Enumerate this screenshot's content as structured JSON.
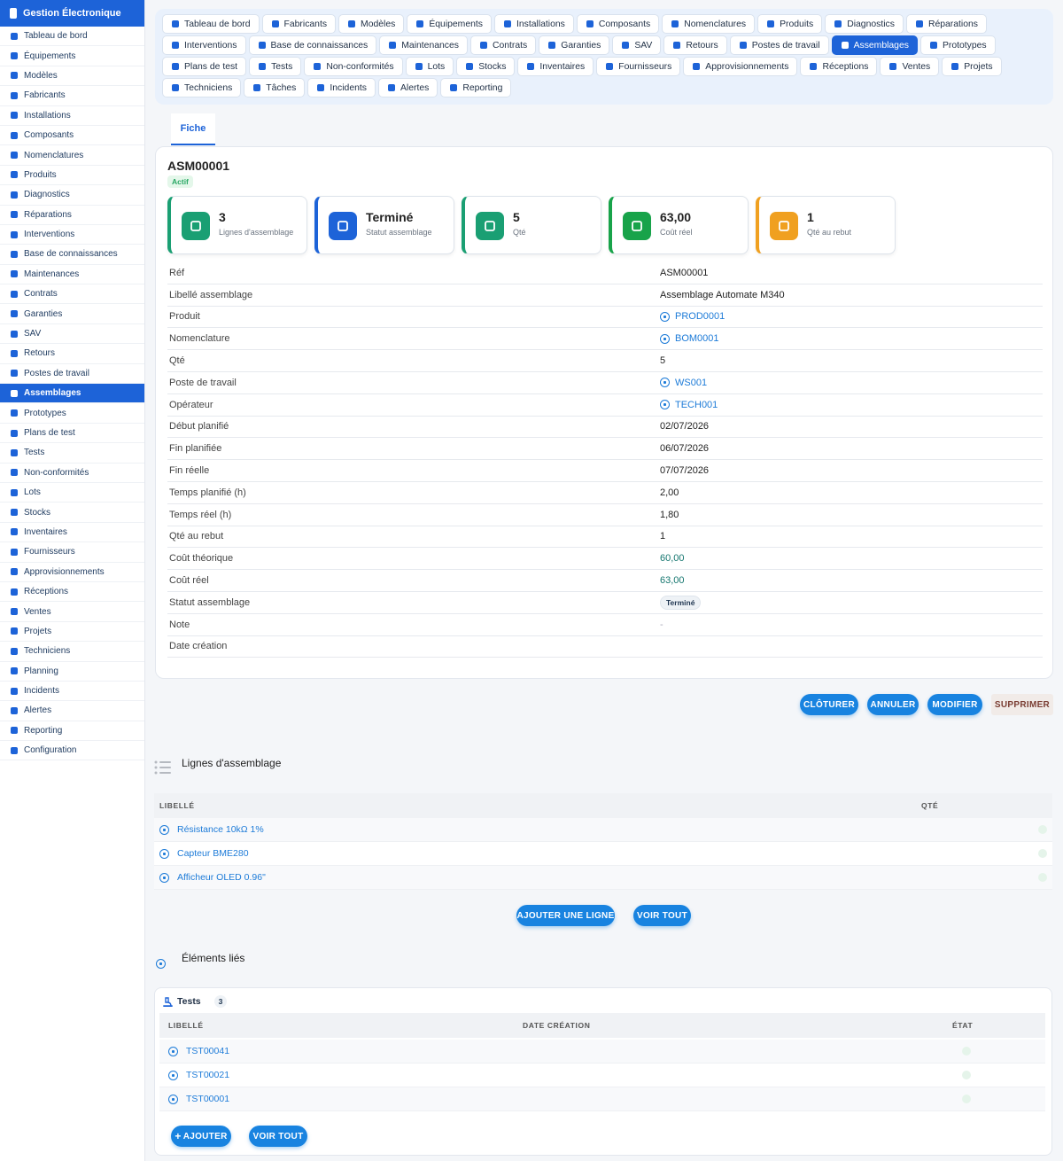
{
  "app": {
    "title": "Gestion Électronique"
  },
  "sidebar": {
    "items": [
      {
        "label": "Tableau de bord",
        "icon": "dashboard-icon"
      },
      {
        "label": "Équipements",
        "icon": "chip-icon"
      },
      {
        "label": "Modèles",
        "icon": "box-icon"
      },
      {
        "label": "Fabricants",
        "icon": "factory-icon"
      },
      {
        "label": "Installations",
        "icon": "network-icon"
      },
      {
        "label": "Composants",
        "icon": "memory-icon"
      },
      {
        "label": "Nomenclatures",
        "icon": "sitemap-icon"
      },
      {
        "label": "Produits",
        "icon": "boxes-icon"
      },
      {
        "label": "Diagnostics",
        "icon": "stethoscope-icon"
      },
      {
        "label": "Réparations",
        "icon": "wrench-icon"
      },
      {
        "label": "Interventions",
        "icon": "hardhat-icon"
      },
      {
        "label": "Base de connaissances",
        "icon": "book-icon"
      },
      {
        "label": "Maintenances",
        "icon": "tools-icon"
      },
      {
        "label": "Contrats",
        "icon": "file-icon"
      },
      {
        "label": "Garanties",
        "icon": "shield-icon"
      },
      {
        "label": "SAV",
        "icon": "lifebuoy-icon"
      },
      {
        "label": "Retours",
        "icon": "undo-icon"
      },
      {
        "label": "Postes de travail",
        "icon": "desktop-icon"
      },
      {
        "label": "Assemblages",
        "icon": "cogs-icon",
        "active": true
      },
      {
        "label": "Prototypes",
        "icon": "flask-icon"
      },
      {
        "label": "Plans de test",
        "icon": "clipboard-icon"
      },
      {
        "label": "Tests",
        "icon": "microscope-icon"
      },
      {
        "label": "Non-conformités",
        "icon": "warning-icon"
      },
      {
        "label": "Lots",
        "icon": "barcode-icon"
      },
      {
        "label": "Stocks",
        "icon": "warehouse-icon"
      },
      {
        "label": "Inventaires",
        "icon": "clipboard-check-icon"
      },
      {
        "label": "Fournisseurs",
        "icon": "truck-icon"
      },
      {
        "label": "Approvisionnements",
        "icon": "dolly-icon"
      },
      {
        "label": "Réceptions",
        "icon": "truck-loading-icon"
      },
      {
        "label": "Ventes",
        "icon": "cart-icon"
      },
      {
        "label": "Projets",
        "icon": "project-icon"
      },
      {
        "label": "Techniciens",
        "icon": "users-cog-icon"
      },
      {
        "label": "Planning",
        "icon": "calendar-icon"
      },
      {
        "label": "Incidents",
        "icon": "bolt-icon"
      },
      {
        "label": "Alertes",
        "icon": "bell-icon"
      },
      {
        "label": "Reporting",
        "icon": "chart-pie-icon"
      },
      {
        "label": "Configuration",
        "icon": "gear-icon"
      }
    ]
  },
  "topnav": {
    "items": [
      {
        "label": "Tableau de bord"
      },
      {
        "label": "Fabricants"
      },
      {
        "label": "Modèles"
      },
      {
        "label": "Équipements"
      },
      {
        "label": "Installations"
      },
      {
        "label": "Composants"
      },
      {
        "label": "Nomenclatures"
      },
      {
        "label": "Produits"
      },
      {
        "label": "Diagnostics"
      },
      {
        "label": "Réparations"
      },
      {
        "label": "Interventions"
      },
      {
        "label": "Base de connaissances"
      },
      {
        "label": "Maintenances"
      },
      {
        "label": "Contrats"
      },
      {
        "label": "Garanties"
      },
      {
        "label": "SAV"
      },
      {
        "label": "Retours"
      },
      {
        "label": "Postes de travail"
      },
      {
        "label": "Assemblages",
        "active": true
      },
      {
        "label": "Prototypes"
      },
      {
        "label": "Plans de test"
      },
      {
        "label": "Tests"
      },
      {
        "label": "Non-conformités"
      },
      {
        "label": "Lots"
      },
      {
        "label": "Stocks"
      },
      {
        "label": "Inventaires"
      },
      {
        "label": "Fournisseurs"
      },
      {
        "label": "Approvisionnements"
      },
      {
        "label": "Réceptions"
      },
      {
        "label": "Ventes"
      },
      {
        "label": "Projets"
      },
      {
        "label": "Techniciens"
      },
      {
        "label": "Tâches"
      },
      {
        "label": "Incidents"
      },
      {
        "label": "Alertes"
      },
      {
        "label": "Reporting"
      }
    ]
  },
  "tabs": {
    "fiche": "Fiche"
  },
  "record": {
    "ref": "ASM00001",
    "status_badge": "Actif"
  },
  "stats": [
    {
      "value": "3",
      "label": "Lignes d'assemblage",
      "color": "#1a9f73",
      "icon": "list-icon",
      "icon_bg": "#1a9f73"
    },
    {
      "value": "Terminé",
      "label": "Statut assemblage",
      "color": "#1d63d8",
      "icon": "flag-icon",
      "icon_bg": "#1d63d8"
    },
    {
      "value": "5",
      "label": "Qté",
      "color": "#1a9f73",
      "icon": "cubes-icon",
      "icon_bg": "#1a9f73"
    },
    {
      "value": "63,00",
      "label": "Coût réel",
      "color": "#18a34a",
      "icon": "coins-icon",
      "icon_bg": "#18a34a"
    },
    {
      "value": "1",
      "label": "Qté au rebut",
      "color": "#f0a020",
      "icon": "trash-icon",
      "icon_bg": "#f0a020"
    }
  ],
  "fields": [
    {
      "label": "Réf",
      "value": "ASM00001"
    },
    {
      "label": "Libellé assemblage",
      "value": "Assemblage Automate M340"
    },
    {
      "label": "Produit",
      "value": "PROD0001",
      "link": true
    },
    {
      "label": "Nomenclature",
      "value": "BOM0001",
      "link": true
    },
    {
      "label": "Qté",
      "value": "5"
    },
    {
      "label": "Poste de travail",
      "value": "WS001",
      "link": true
    },
    {
      "label": "Opérateur",
      "value": "TECH001",
      "link": true
    },
    {
      "label": "Début planifié",
      "value": "02/07/2026"
    },
    {
      "label": "Fin planifiée",
      "value": "06/07/2026"
    },
    {
      "label": "Fin réelle",
      "value": "07/07/2026"
    },
    {
      "label": "Temps planifié (h)",
      "value": "2,00"
    },
    {
      "label": "Temps réel (h)",
      "value": "1,80"
    },
    {
      "label": "Qté au rebut",
      "value": "1"
    },
    {
      "label": "Coût théorique",
      "value": "60,00",
      "teal": true
    },
    {
      "label": "Coût réel",
      "value": "63,00",
      "teal": true
    },
    {
      "label": "Statut assemblage",
      "value": "Terminé",
      "pill": true
    },
    {
      "label": "Note",
      "value": "-",
      "muted": true
    },
    {
      "label": "Date création",
      "value": ""
    }
  ],
  "actions": {
    "cloturer": "CLÔTURER",
    "annuler": "ANNULER",
    "modifier": "MODIFIER",
    "supprimer": "SUPPRIMER"
  },
  "lines_section": {
    "title": "Lignes d'assemblage",
    "col_libelle": "LIBELLÉ",
    "col_qte": "QTÉ",
    "rows": [
      {
        "libelle": "Résistance 10kΩ 1%"
      },
      {
        "libelle": "Capteur BME280"
      },
      {
        "libelle": "Afficheur OLED 0.96\""
      }
    ],
    "add_label": "AJOUTER UNE LIGNE",
    "all_label": "VOIR TOUT"
  },
  "linked_section": {
    "title": "Éléments liés",
    "tests_title": "Tests",
    "tests_count": "3",
    "col_libelle": "LIBELLÉ",
    "col_date": "DATE CRÉATION",
    "col_etat": "ÉTAT",
    "rows": [
      {
        "libelle": "TST00041"
      },
      {
        "libelle": "TST00021"
      },
      {
        "libelle": "TST00001"
      }
    ],
    "add_label": "AJOUTER",
    "all_label": "VOIR TOUT"
  },
  "colors": {
    "primary": "#1d63d8",
    "accent": "#1883e0",
    "teal": "#15766f"
  }
}
